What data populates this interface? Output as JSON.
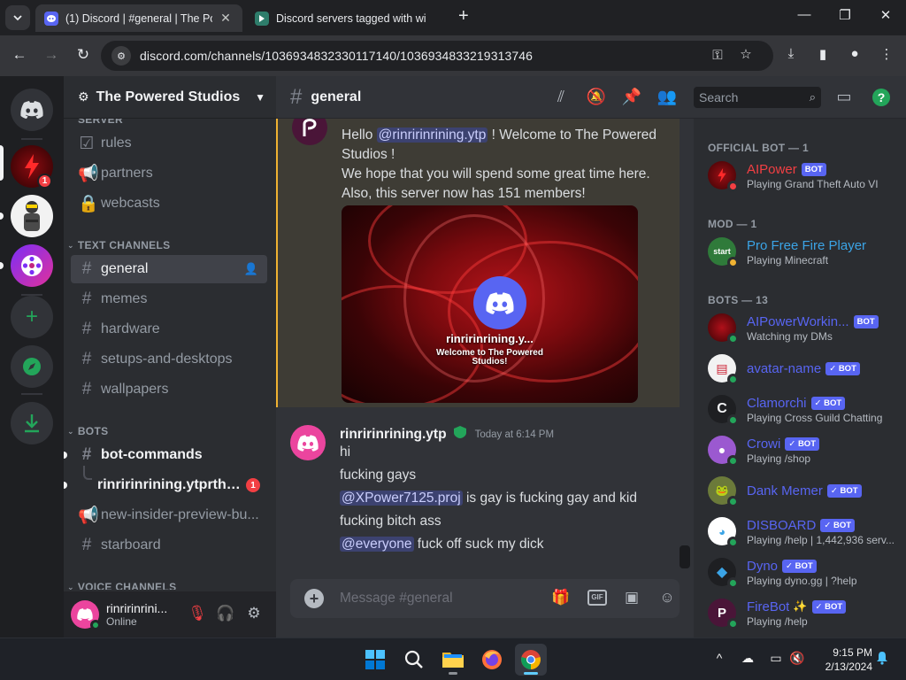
{
  "browser": {
    "tabs": [
      {
        "title": "(1) Discord | #general | The Pow",
        "active": true
      },
      {
        "title": "Discord servers tagged with wi",
        "active": false
      }
    ],
    "url": "discord.com/channels/1036934832330117140/1036934833219313746"
  },
  "server": {
    "name": "The Powered Studios",
    "categories": {
      "server": "SERVER",
      "text": "TEXT CHANNELS",
      "bots": "BOTS",
      "voice": "VOICE CHANNELS"
    },
    "channels": {
      "rules": "rules",
      "partners": "partners",
      "webcasts": "webcasts",
      "general": "general",
      "memes": "memes",
      "hardware": "hardware",
      "setups": "setups-and-desktops",
      "wallpapers": "wallpapers",
      "bot_commands": "bot-commands",
      "thread": "rinririnrining.ytprth7'...",
      "insider": "new-insider-preview-bu...",
      "starboard": "starboard"
    },
    "thread_badge": "1"
  },
  "guild_badge": "1",
  "user": {
    "name": "rinririnrini...",
    "status": "Online"
  },
  "chat": {
    "channel": "general",
    "search_placeholder": "Search",
    "welcome": {
      "hello": "Hello",
      "mention": "@rinririnrining.ytp",
      "line1_rest": "! Welcome to The Powered Studios !",
      "line2": "We hope that you will spend some great time here. Also, this server now has 151 members!",
      "embed_name": "rinririnrining.y...",
      "embed_sub": "Welcome to The Powered Studios!"
    },
    "message": {
      "author": "rinririnrining.ytp",
      "time": "Today at 6:14 PM",
      "line1": "hi",
      "line2": "fucking gays",
      "mention3": "@XPower7125.proj",
      "line3_rest": " is gay is fucking gay and kid",
      "line4": "fucking bitch ass",
      "mention5": "@everyone",
      "line5_rest": " fuck off suck my dick"
    },
    "composer_placeholder": "Message #general"
  },
  "members": {
    "groups": [
      {
        "label": "OFFICIAL BOT — 1"
      },
      {
        "label": "MOD — 1"
      },
      {
        "label": "BOTS — 13"
      }
    ],
    "list": [
      {
        "name": "AIPower",
        "activity": "Playing Grand Theft Auto VI",
        "bot": "BOT",
        "color": "#f23f43"
      },
      {
        "name": "Pro Free Fire Player",
        "activity": "Playing Minecraft",
        "bot": "",
        "color": "#3ba4e6"
      },
      {
        "name": "AIPowerWorkin...",
        "activity": "Watching my DMs",
        "bot": "BOT",
        "color": "#5865f2"
      },
      {
        "name": "avatar-name",
        "activity": "",
        "bot": "✓ BOT",
        "color": "#5865f2"
      },
      {
        "name": "Clamorchi",
        "activity": "Playing Cross Guild Chatting",
        "bot": "✓ BOT",
        "color": "#5865f2"
      },
      {
        "name": "Crowi",
        "activity": "Playing /shop",
        "bot": "✓ BOT",
        "color": "#5865f2"
      },
      {
        "name": "Dank Memer",
        "activity": "",
        "bot": "✓ BOT",
        "color": "#5865f2"
      },
      {
        "name": "DISBOARD",
        "activity": "Playing /help | 1,442,936 serv...",
        "bot": "✓ BOT",
        "color": "#5865f2"
      },
      {
        "name": "Dyno",
        "activity": "Playing dyno.gg | ?help",
        "bot": "✓ BOT",
        "color": "#5865f2"
      },
      {
        "name": "FireBot",
        "activity": "Playing /help",
        "bot": "✓ BOT",
        "color": "#5865f2"
      }
    ]
  },
  "taskbar": {
    "time": "9:15 PM",
    "date": "2/13/2024"
  },
  "colors": {
    "blurple": "#5865f2",
    "online": "#23a55a",
    "dnd": "#f23f43",
    "idle": "#f0b232"
  }
}
